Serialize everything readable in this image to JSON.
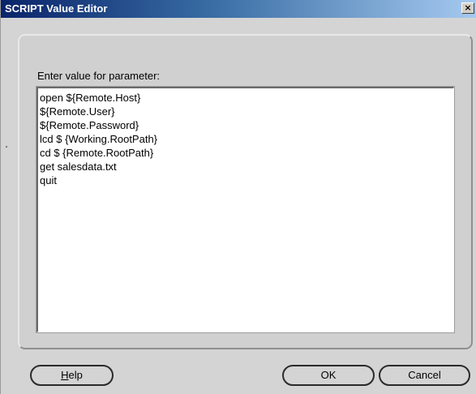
{
  "window": {
    "title": "SCRIPT Value Editor",
    "close_glyph": "×"
  },
  "dialog": {
    "prompt_label": "Enter value for parameter:",
    "script_lines": [
      "open ${Remote.Host}",
      "${Remote.User}",
      "${Remote.Password}",
      "lcd $ {Working.RootPath}",
      "cd $ {Remote.RootPath}",
      "get salesdata.txt",
      "quit"
    ]
  },
  "buttons": {
    "help": {
      "mnemonic": "H",
      "rest": "elp"
    },
    "ok": "OK",
    "cancel": "Cancel"
  },
  "icons": {
    "close": "close-icon"
  }
}
